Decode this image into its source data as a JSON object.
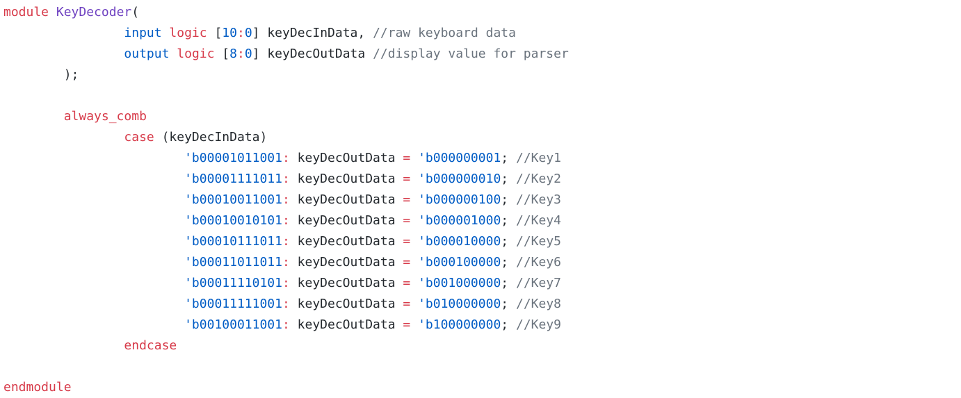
{
  "code": {
    "language": "systemverilog",
    "colors": {
      "keyword_red": "#d73a49",
      "keyword_blue": "#005cc5",
      "title_purple": "#6f42c1",
      "comment_gray": "#6a737d",
      "text": "#24292e",
      "background": "#ffffff"
    },
    "lines": [
      [
        {
          "t": "module",
          "c": "kw-red"
        },
        {
          "t": " ",
          "c": "plain"
        },
        {
          "t": "KeyDecoder",
          "c": "kw-purple"
        },
        {
          "t": "(",
          "c": "plain"
        }
      ],
      [
        {
          "t": "                ",
          "c": "plain"
        },
        {
          "t": "input",
          "c": "kw-blue"
        },
        {
          "t": " ",
          "c": "plain"
        },
        {
          "t": "logic",
          "c": "kw-red"
        },
        {
          "t": " [",
          "c": "plain"
        },
        {
          "t": "10",
          "c": "num-blue"
        },
        {
          "t": ":",
          "c": "op-red"
        },
        {
          "t": "0",
          "c": "num-blue"
        },
        {
          "t": "] keyDecInData, ",
          "c": "plain"
        },
        {
          "t": "//raw keyboard data",
          "c": "comment"
        }
      ],
      [
        {
          "t": "                ",
          "c": "plain"
        },
        {
          "t": "output",
          "c": "kw-blue"
        },
        {
          "t": " ",
          "c": "plain"
        },
        {
          "t": "logic",
          "c": "kw-red"
        },
        {
          "t": " [",
          "c": "plain"
        },
        {
          "t": "8",
          "c": "num-blue"
        },
        {
          "t": ":",
          "c": "op-red"
        },
        {
          "t": "0",
          "c": "num-blue"
        },
        {
          "t": "] keyDecOutData ",
          "c": "plain"
        },
        {
          "t": "//display value for parser",
          "c": "comment"
        }
      ],
      [
        {
          "t": "        );",
          "c": "plain"
        }
      ],
      [],
      [
        {
          "t": "        ",
          "c": "plain"
        },
        {
          "t": "always_comb",
          "c": "kw-red"
        }
      ],
      [
        {
          "t": "                ",
          "c": "plain"
        },
        {
          "t": "case",
          "c": "kw-red"
        },
        {
          "t": " (keyDecInData)",
          "c": "plain"
        }
      ],
      [
        {
          "t": "                        ",
          "c": "plain"
        },
        {
          "t": "'b00001011001",
          "c": "num-blue"
        },
        {
          "t": ":",
          "c": "op-red"
        },
        {
          "t": " keyDecOutData ",
          "c": "plain"
        },
        {
          "t": "=",
          "c": "op-red"
        },
        {
          "t": " ",
          "c": "plain"
        },
        {
          "t": "'b000000001",
          "c": "num-blue"
        },
        {
          "t": "; ",
          "c": "plain"
        },
        {
          "t": "//Key1",
          "c": "comment"
        }
      ],
      [
        {
          "t": "                        ",
          "c": "plain"
        },
        {
          "t": "'b00001111011",
          "c": "num-blue"
        },
        {
          "t": ":",
          "c": "op-red"
        },
        {
          "t": " keyDecOutData ",
          "c": "plain"
        },
        {
          "t": "=",
          "c": "op-red"
        },
        {
          "t": " ",
          "c": "plain"
        },
        {
          "t": "'b000000010",
          "c": "num-blue"
        },
        {
          "t": "; ",
          "c": "plain"
        },
        {
          "t": "//Key2",
          "c": "comment"
        }
      ],
      [
        {
          "t": "                        ",
          "c": "plain"
        },
        {
          "t": "'b00010011001",
          "c": "num-blue"
        },
        {
          "t": ":",
          "c": "op-red"
        },
        {
          "t": " keyDecOutData ",
          "c": "plain"
        },
        {
          "t": "=",
          "c": "op-red"
        },
        {
          "t": " ",
          "c": "plain"
        },
        {
          "t": "'b000000100",
          "c": "num-blue"
        },
        {
          "t": "; ",
          "c": "plain"
        },
        {
          "t": "//Key3",
          "c": "comment"
        }
      ],
      [
        {
          "t": "                        ",
          "c": "plain"
        },
        {
          "t": "'b00010010101",
          "c": "num-blue"
        },
        {
          "t": ":",
          "c": "op-red"
        },
        {
          "t": " keyDecOutData ",
          "c": "plain"
        },
        {
          "t": "=",
          "c": "op-red"
        },
        {
          "t": " ",
          "c": "plain"
        },
        {
          "t": "'b000001000",
          "c": "num-blue"
        },
        {
          "t": "; ",
          "c": "plain"
        },
        {
          "t": "//Key4",
          "c": "comment"
        }
      ],
      [
        {
          "t": "                        ",
          "c": "plain"
        },
        {
          "t": "'b00010111011",
          "c": "num-blue"
        },
        {
          "t": ":",
          "c": "op-red"
        },
        {
          "t": " keyDecOutData ",
          "c": "plain"
        },
        {
          "t": "=",
          "c": "op-red"
        },
        {
          "t": " ",
          "c": "plain"
        },
        {
          "t": "'b000010000",
          "c": "num-blue"
        },
        {
          "t": "; ",
          "c": "plain"
        },
        {
          "t": "//Key5",
          "c": "comment"
        }
      ],
      [
        {
          "t": "                        ",
          "c": "plain"
        },
        {
          "t": "'b00011011011",
          "c": "num-blue"
        },
        {
          "t": ":",
          "c": "op-red"
        },
        {
          "t": " keyDecOutData ",
          "c": "plain"
        },
        {
          "t": "=",
          "c": "op-red"
        },
        {
          "t": " ",
          "c": "plain"
        },
        {
          "t": "'b000100000",
          "c": "num-blue"
        },
        {
          "t": "; ",
          "c": "plain"
        },
        {
          "t": "//Key6",
          "c": "comment"
        }
      ],
      [
        {
          "t": "                        ",
          "c": "plain"
        },
        {
          "t": "'b00011110101",
          "c": "num-blue"
        },
        {
          "t": ":",
          "c": "op-red"
        },
        {
          "t": " keyDecOutData ",
          "c": "plain"
        },
        {
          "t": "=",
          "c": "op-red"
        },
        {
          "t": " ",
          "c": "plain"
        },
        {
          "t": "'b001000000",
          "c": "num-blue"
        },
        {
          "t": "; ",
          "c": "plain"
        },
        {
          "t": "//Key7",
          "c": "comment"
        }
      ],
      [
        {
          "t": "                        ",
          "c": "plain"
        },
        {
          "t": "'b00011111001",
          "c": "num-blue"
        },
        {
          "t": ":",
          "c": "op-red"
        },
        {
          "t": " keyDecOutData ",
          "c": "plain"
        },
        {
          "t": "=",
          "c": "op-red"
        },
        {
          "t": " ",
          "c": "plain"
        },
        {
          "t": "'b010000000",
          "c": "num-blue"
        },
        {
          "t": "; ",
          "c": "plain"
        },
        {
          "t": "//Key8",
          "c": "comment"
        }
      ],
      [
        {
          "t": "                        ",
          "c": "plain"
        },
        {
          "t": "'b00100011001",
          "c": "num-blue"
        },
        {
          "t": ":",
          "c": "op-red"
        },
        {
          "t": " keyDecOutData ",
          "c": "plain"
        },
        {
          "t": "=",
          "c": "op-red"
        },
        {
          "t": " ",
          "c": "plain"
        },
        {
          "t": "'b100000000",
          "c": "num-blue"
        },
        {
          "t": "; ",
          "c": "plain"
        },
        {
          "t": "//Key9",
          "c": "comment"
        }
      ],
      [
        {
          "t": "                ",
          "c": "plain"
        },
        {
          "t": "endcase",
          "c": "kw-red"
        }
      ],
      [],
      [
        {
          "t": "endmodule",
          "c": "kw-red"
        }
      ]
    ]
  }
}
